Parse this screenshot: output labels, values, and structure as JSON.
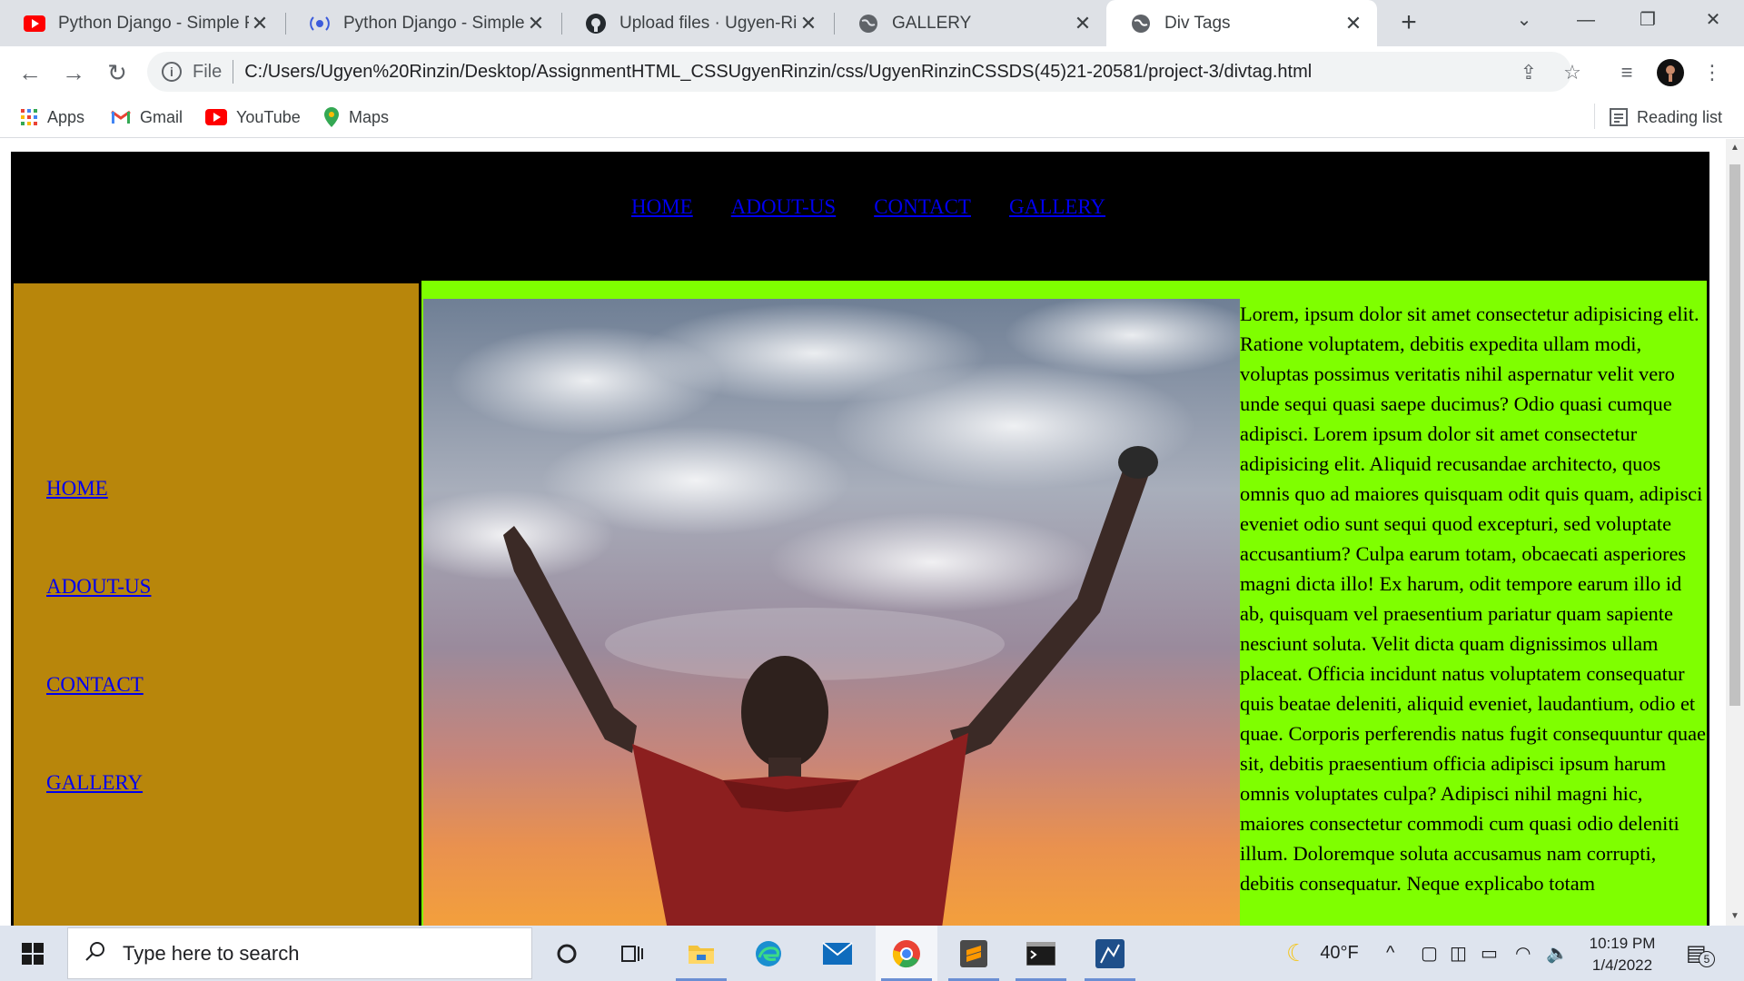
{
  "browser": {
    "tabs": [
      {
        "title": "Python Django - Simple R",
        "icon": "youtube-icon"
      },
      {
        "title": "Python Django - Simple R",
        "icon": "broadcast-icon"
      },
      {
        "title": "Upload files · Ugyen-Rinzi",
        "icon": "github-icon"
      },
      {
        "title": "GALLERY",
        "icon": "globe-icon"
      },
      {
        "title": "Div Tags",
        "icon": "globe-icon",
        "active": true
      }
    ],
    "address": {
      "scheme_label": "File",
      "url": "C:/Users/Ugyen%20Rinzin/Desktop/AssignmentHTML_CSSUgyenRinzin/css/UgyenRinzinCSSDS(45)21-20581/project-3/divtag.html"
    },
    "bookmarks": [
      {
        "label": "Apps",
        "icon": "apps-grid-icon"
      },
      {
        "label": "Gmail",
        "icon": "gmail-icon"
      },
      {
        "label": "YouTube",
        "icon": "youtube-icon"
      },
      {
        "label": "Maps",
        "icon": "maps-pin-icon"
      }
    ],
    "reading_list_label": "Reading list"
  },
  "page": {
    "top_nav": [
      "HOME",
      "ADOUT-US",
      "CONTACT",
      "GALLERY"
    ],
    "side_nav": [
      "HOME",
      "ADOUT-US",
      "CONTACT",
      "GALLERY"
    ],
    "body_text": "Lorem, ipsum dolor sit amet consectetur adipisicing elit. Ratione voluptatem, debitis expedita ullam modi, voluptas possimus veritatis nihil aspernatur velit vero unde sequi quasi saepe ducimus? Odio quasi cumque adipisci. Lorem ipsum dolor sit amet consectetur adipisicing elit. Aliquid recusandae architecto, quos omnis quo ad maiores quisquam odit quis quam, adipisci eveniet odio sunt sequi quod excepturi, sed voluptate accusantium? Culpa earum totam, obcaecati asperiores magni dicta illo! Ex harum, odit tempore earum illo id ab, quisquam vel praesentium pariatur quam sapiente nesciunt soluta. Velit dicta quam dignissimos ullam placeat. Officia incidunt natus voluptatem consequatur quis beatae deleniti, aliquid eveniet, laudantium, odio et quae. Corporis perferendis natus fugit consequuntur quae sit, debitis praesentium officia adipisci ipsum harum omnis voluptates culpa? Adipisci nihil magni hic, maiores consectetur commodi cum quasi odio deleniti illum. Doloremque soluta accusamus nam corrupti, debitis consequatur. Neque explicabo totam",
    "colors": {
      "header_bg": "#000000",
      "sidebar_bg": "#b8860b",
      "main_bg": "#7fff00",
      "link": "#0000ee"
    }
  },
  "taskbar": {
    "search_placeholder": "Type here to search",
    "weather": "40°F",
    "time": "10:19 PM",
    "date": "1/4/2022",
    "notification_count": "5"
  }
}
